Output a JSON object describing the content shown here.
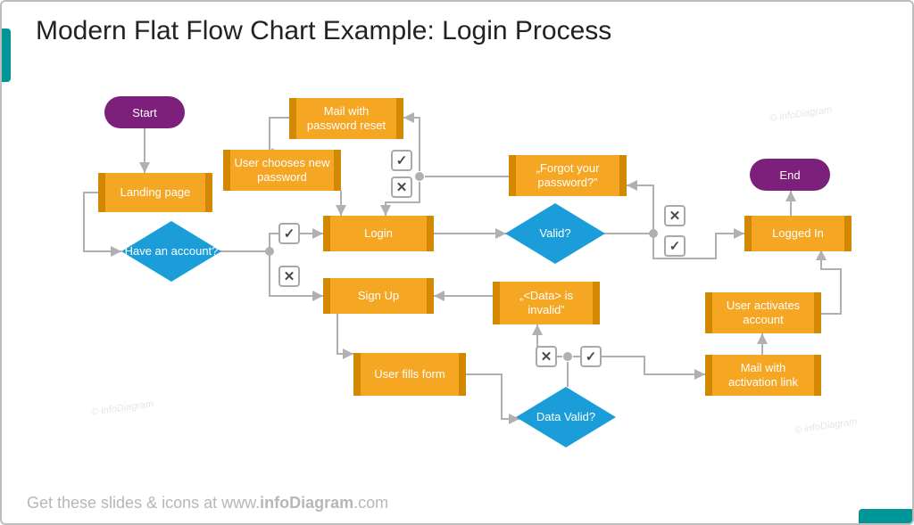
{
  "title": "Modern Flat Flow Chart Example: Login Process",
  "footer_lead": "Get these slides & icons at www.",
  "footer_bold": "infoDiagram",
  "footer_tail": ".com",
  "watermark": "© infoDiagram",
  "nodes": {
    "start": "Start",
    "end": "End",
    "landing": "Landing page",
    "mail_reset": "Mail with password reset",
    "choose_pw": "User chooses new password",
    "forgot": "„Forgot your password?”",
    "login": "Login",
    "signup": "Sign Up",
    "data_invalid": "„<Data> is invalid”",
    "logged_in": "Logged In",
    "fills_form": "User fills form",
    "activates": "User activates account",
    "mail_activation": "Mail with activation link",
    "have_account": "Have an account?",
    "valid": "Valid?",
    "data_valid": "Data Valid?"
  },
  "colors": {
    "process": "#f5a623",
    "process_edge": "#d28800",
    "decision": "#1b9dd9",
    "terminator": "#7c207c",
    "connector": "#b0b0b0",
    "accent": "#009698"
  },
  "chart_data": {
    "type": "flowchart",
    "title": "Login Process",
    "nodes": [
      {
        "id": "start",
        "kind": "terminator",
        "label": "Start"
      },
      {
        "id": "landing",
        "kind": "process",
        "label": "Landing page"
      },
      {
        "id": "have_account",
        "kind": "decision",
        "label": "Have an account?"
      },
      {
        "id": "login",
        "kind": "process",
        "label": "Login"
      },
      {
        "id": "signup",
        "kind": "process",
        "label": "Sign Up"
      },
      {
        "id": "valid",
        "kind": "decision",
        "label": "Valid?"
      },
      {
        "id": "forgot",
        "kind": "process",
        "label": "„Forgot your password?”"
      },
      {
        "id": "mail_reset",
        "kind": "process",
        "label": "Mail with password reset"
      },
      {
        "id": "choose_pw",
        "kind": "process",
        "label": "User chooses new password"
      },
      {
        "id": "logged_in",
        "kind": "process",
        "label": "Logged In"
      },
      {
        "id": "end",
        "kind": "terminator",
        "label": "End"
      },
      {
        "id": "fills_form",
        "kind": "process",
        "label": "User fills form"
      },
      {
        "id": "data_valid",
        "kind": "decision",
        "label": "Data Valid?"
      },
      {
        "id": "data_invalid",
        "kind": "process",
        "label": "„<Data> is invalid”"
      },
      {
        "id": "mail_activation",
        "kind": "process",
        "label": "Mail with activation link"
      },
      {
        "id": "activates",
        "kind": "process",
        "label": "User activates account"
      }
    ],
    "edges": [
      {
        "from": "start",
        "to": "landing"
      },
      {
        "from": "landing",
        "to": "have_account"
      },
      {
        "from": "have_account",
        "to": "login",
        "label": "yes"
      },
      {
        "from": "have_account",
        "to": "signup",
        "label": "no"
      },
      {
        "from": "login",
        "to": "valid"
      },
      {
        "from": "valid",
        "to": "logged_in",
        "label": "yes"
      },
      {
        "from": "valid",
        "to": "forgot",
        "label": "no"
      },
      {
        "from": "forgot",
        "to": "mail_reset",
        "label": "yes"
      },
      {
        "from": "forgot",
        "to": "login",
        "label": "no"
      },
      {
        "from": "mail_reset",
        "to": "choose_pw"
      },
      {
        "from": "choose_pw",
        "to": "login"
      },
      {
        "from": "logged_in",
        "to": "end"
      },
      {
        "from": "signup",
        "to": "fills_form"
      },
      {
        "from": "fills_form",
        "to": "data_valid"
      },
      {
        "from": "data_valid",
        "to": "mail_activation",
        "label": "yes"
      },
      {
        "from": "data_valid",
        "to": "data_invalid",
        "label": "no"
      },
      {
        "from": "data_invalid",
        "to": "signup"
      },
      {
        "from": "mail_activation",
        "to": "activates"
      },
      {
        "from": "activates",
        "to": "logged_in"
      }
    ]
  }
}
